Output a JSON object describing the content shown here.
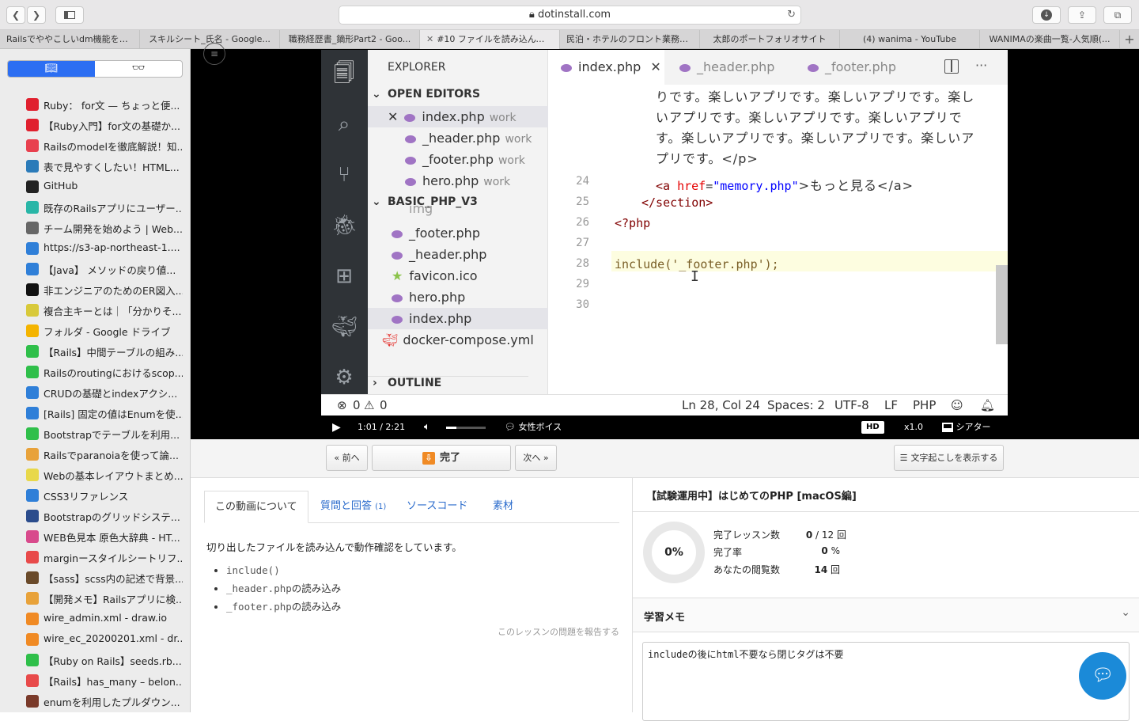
{
  "browser": {
    "url": "dotinstall.com",
    "tabs": [
      "Railsでややこしいdm機能を1...",
      "スキルシート_氏名 - Google...",
      "職務経歴書_鏑形Part2 - Goo...",
      "#10 ファイルを読み込んでみよ...",
      "民泊・ホテルのフロント業務す...",
      "太郎のポートフォリオサイト",
      "(4) wanima - YouTube",
      "WANIMAの楽曲一覧-人気順(..."
    ]
  },
  "sidebar": {
    "bookmarks": [
      {
        "label": "Ruby： for文 — ちょっと便...",
        "color": "#e0202e"
      },
      {
        "label": "【Ruby入門】for文の基礎か...",
        "color": "#e0202e"
      },
      {
        "label": "Railsのmodelを徹底解説！知...",
        "color": "#e8404e"
      },
      {
        "label": "表で見やすくしたい！HTML...",
        "color": "#2b7bb9"
      },
      {
        "label": "GitHub",
        "color": "#222222"
      },
      {
        "label": "既存のRailsアプリにユーザー...",
        "color": "#29b6a7"
      },
      {
        "label": "チーム開発を始めよう | Web...",
        "color": "#666666"
      },
      {
        "label": "https://s3-ap-northeast-1....",
        "color": "#2f7fd8"
      },
      {
        "label": "【Java】 メソッドの戻り値...",
        "color": "#2f7fd8"
      },
      {
        "label": "非エンジニアのためのER図入...",
        "color": "#111111"
      },
      {
        "label": "複合主キーとは｜「分かりそ...",
        "color": "#d8c93a"
      },
      {
        "label": "フォルダ - Google ドライブ",
        "color": "#f4b400"
      },
      {
        "label": "【Rails】中間テーブルの組み...",
        "color": "#2fbf4a"
      },
      {
        "label": "Railsのroutingにおけるscop...",
        "color": "#2fbf4a"
      },
      {
        "label": "CRUDの基礎とindexアクシ...",
        "color": "#2f7fd8"
      },
      {
        "label": "[Rails] 固定の値はEnumを使...",
        "color": "#2f7fd8"
      },
      {
        "label": "Bootstrapでテーブルを利用...",
        "color": "#2fbf4a"
      },
      {
        "label": "Railsでparanoiaを使って論...",
        "color": "#e8a23a"
      },
      {
        "label": "Webの基本レイアウトまとめ...",
        "color": "#e8d84a"
      },
      {
        "label": "CSS3リファレンス",
        "color": "#2f7fd8"
      },
      {
        "label": "Bootstrapのグリッドシステ...",
        "color": "#2b4c8c"
      },
      {
        "label": "WEB色見本 原色大辞典 - HT...",
        "color": "#d84a8c"
      },
      {
        "label": "marginースタイルシートリフ...",
        "color": "#e84a4a"
      },
      {
        "label": "【sass】scss内の記述で背景...",
        "color": "#6a4a2a"
      },
      {
        "label": "【開発メモ】Railsアプリに検...",
        "color": "#e8a23a"
      },
      {
        "label": "wire_admin.xml - draw.io",
        "color": "#f08a24"
      },
      {
        "label": "wire_ec_20200201.xml - dr...",
        "color": "#f08a24"
      },
      {
        "label": "【Ruby on Rails】seeds.rb...",
        "color": "#2fbf4a"
      },
      {
        "label": "【Rails】has_many – belon...",
        "color": "#e84a4a"
      },
      {
        "label": "enumを利用したプルダウン...",
        "color": "#7a3a2a"
      }
    ]
  },
  "vscode": {
    "explorer_title": "EXPLORER",
    "open_editors_title": "OPEN EDITORS",
    "open_editors": [
      {
        "name": "index.php",
        "dir": "work"
      },
      {
        "name": "_header.php",
        "dir": "work"
      },
      {
        "name": "_footer.php",
        "dir": "work"
      },
      {
        "name": "hero.php",
        "dir": "work"
      }
    ],
    "project_title": "BASIC_PHP_V3",
    "project_files": [
      "img",
      "_footer.php",
      "_header.php",
      "favicon.ico",
      "hero.php",
      "index.php",
      "docker-compose.yml"
    ],
    "outline_title": "OUTLINE",
    "editor_tabs": [
      "index.php",
      "_header.php",
      "_footer.php"
    ],
    "code_text_lines": [
      "りです。楽しいアプリです。楽しいアプリです。楽し",
      "いアプリです。楽しいアプリです。楽しいアプリで",
      "す。楽しいアプリです。楽しいアプリです。楽しいア",
      "プリです。</p>"
    ],
    "line_numbers": [
      "24",
      "25",
      "26",
      "27",
      "28",
      "29",
      "30"
    ],
    "line24": {
      "open": "<a",
      "attr": "href",
      "eq": "=",
      "val": "\"memory.php\"",
      "text": ">もっと見る</a>"
    },
    "line25": "</section>",
    "line26": "<?php",
    "line28": "include('_footer.php');",
    "status": {
      "errors": "0",
      "warnings": "0",
      "position": "Ln 28, Col 24",
      "spaces": "Spaces: 2",
      "encoding": "UTF-8",
      "eol": "LF",
      "language": "PHP"
    }
  },
  "player": {
    "time_current": "1:01",
    "time_sep": "/",
    "time_total": "2:21",
    "voice": "女性ボイス",
    "hd": "HD",
    "speed": "x1.0",
    "theater": "シアター",
    "progress": 0.43,
    "volume": 0.25
  },
  "lesson": {
    "prev": "« 前へ",
    "done": "完了",
    "next": "次へ »",
    "transcript": "文字起こしを表示する",
    "tabs": {
      "about": "この動画について",
      "qa": "質問と回答",
      "qa_count": "(1)",
      "source": "ソースコード",
      "materials": "素材"
    },
    "description": "切り出したファイルを読み込んで動作確認をしています。",
    "bullets": [
      {
        "code": "include()",
        "text": ""
      },
      {
        "code": "_header.php",
        "text": "の読み込み"
      },
      {
        "code": "_footer.php",
        "text": "の読み込み"
      }
    ],
    "report": "このレッスンの問題を報告する"
  },
  "course": {
    "title": "【試験運用中】はじめてのPHP [macOS編]",
    "percent": "0%",
    "stats": [
      {
        "label": "完了レッスン数",
        "value": "0",
        "suffix": " / 12 回"
      },
      {
        "label": "完了率",
        "value": "0",
        "suffix": " %"
      },
      {
        "label": "あなたの閲覧数",
        "value": "14",
        "suffix": " 回"
      }
    ],
    "memo_title": "学習メモ",
    "memo_text": "includeの後にhtml不要なら閉じタグは不要"
  }
}
